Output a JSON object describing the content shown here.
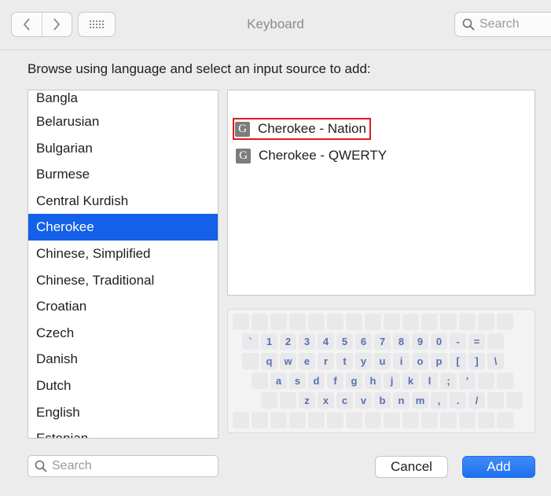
{
  "window": {
    "title": "Keyboard"
  },
  "toolbar": {
    "search_placeholder": "Search"
  },
  "prompt": "Browse using language and select an input source to add:",
  "languages": [
    {
      "label": "Bangla",
      "selected": false
    },
    {
      "label": "Belarusian",
      "selected": false
    },
    {
      "label": "Bulgarian",
      "selected": false
    },
    {
      "label": "Burmese",
      "selected": false
    },
    {
      "label": "Central Kurdish",
      "selected": false
    },
    {
      "label": "Cherokee",
      "selected": true
    },
    {
      "label": "Chinese, Simplified",
      "selected": false
    },
    {
      "label": "Chinese, Traditional",
      "selected": false
    },
    {
      "label": "Croatian",
      "selected": false
    },
    {
      "label": "Czech",
      "selected": false
    },
    {
      "label": "Danish",
      "selected": false
    },
    {
      "label": "Dutch",
      "selected": false
    },
    {
      "label": "English",
      "selected": false
    },
    {
      "label": "Estonian",
      "selected": false
    }
  ],
  "sources": [
    {
      "label": "Cherokee - Nation",
      "icon": "G",
      "highlighted": true
    },
    {
      "label": "Cherokee - QWERTY",
      "icon": "G",
      "highlighted": false
    }
  ],
  "keyboard": {
    "row1": [
      "`",
      "1",
      "2",
      "3",
      "4",
      "5",
      "6",
      "7",
      "8",
      "9",
      "0",
      "-",
      "="
    ],
    "row2": [
      "q",
      "w",
      "e",
      "r",
      "t",
      "y",
      "u",
      "i",
      "o",
      "p",
      "[",
      "]",
      "\\"
    ],
    "row3": [
      "a",
      "s",
      "d",
      "f",
      "g",
      "h",
      "j",
      "k",
      "l",
      ";",
      "'"
    ],
    "row4": [
      "z",
      "x",
      "c",
      "v",
      "b",
      "n",
      "m",
      ",",
      ".",
      "/"
    ]
  },
  "bottom": {
    "search_placeholder": "Search",
    "cancel_label": "Cancel",
    "add_label": "Add"
  },
  "colors": {
    "selection": "#1560e8",
    "highlight_border": "#e3171f",
    "key_text": "#5571b0",
    "add_button": "#1f6ff0"
  }
}
